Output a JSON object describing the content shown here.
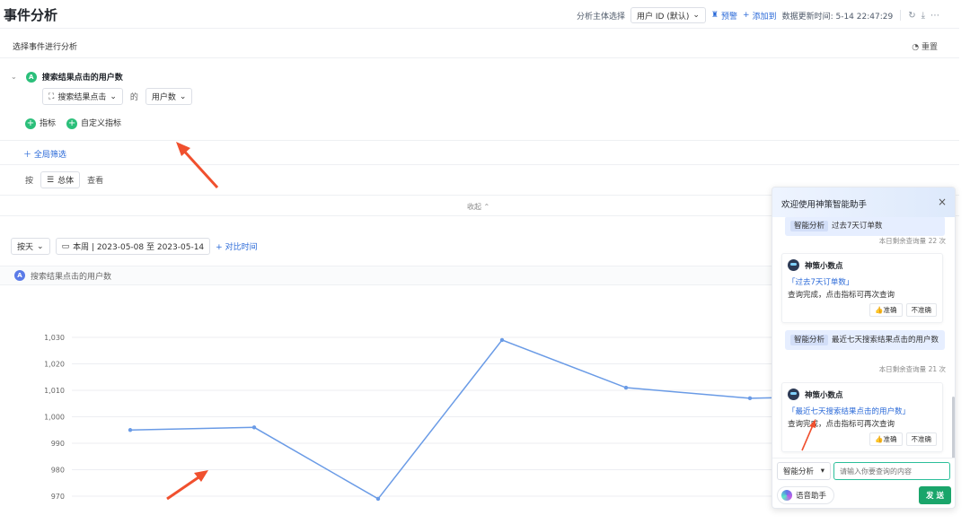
{
  "header": {
    "title": "事件分析",
    "subject_label": "分析主体选择",
    "subject_value": "用户 ID (默认)",
    "alert_label": "预警",
    "add_label": "添加到",
    "update_label": "数据更新时间: 5-14 22:47:29"
  },
  "panel": {
    "section_title": "选择事件进行分析",
    "reset_label": "重置",
    "event_badge": "A",
    "event_name": "搜索结果点击的用户数",
    "event_select": "搜索结果点击",
    "of_label": "的",
    "metric_select": "用户数",
    "add_metric_label": "指标",
    "add_custom_metric_label": "自定义指标",
    "global_filter_label": "全局筛选",
    "group_by_prefix": "按",
    "group_by_value": "总体",
    "group_by_suffix": "查看",
    "collapse_label": "收起"
  },
  "controls": {
    "granularity": "按天",
    "date_range": "本周 | 2023-05-08 至 2023-05-14",
    "compare_label": "对比时间"
  },
  "legend": {
    "badge": "A",
    "label": "搜索结果点击的用户数"
  },
  "colors": {
    "accent_blue": "#2b6ad8",
    "accent_green": "#2bbf7a",
    "line": "#6a9be6",
    "annotation_red": "#f0502e"
  },
  "chart_data": {
    "type": "line",
    "yticks": [
      "1,030",
      "1,020",
      "1,010",
      "1,000",
      "990",
      "980",
      "970"
    ],
    "ylim": [
      960,
      1035
    ],
    "x": [
      1,
      2,
      3,
      4,
      5,
      6,
      7
    ],
    "series": [
      {
        "values": [
          995,
          996,
          969,
          1029,
          1011,
          1007,
          1008
        ]
      }
    ],
    "grid": true
  },
  "assistant": {
    "title": "欢迎使用神策智能助手",
    "close_icon": "close-icon",
    "messages": [
      {
        "kind": "question",
        "tag": "智能分析",
        "text": "过去7天订单数",
        "remain": "本日剩余查询量 22 次"
      },
      {
        "kind": "answer",
        "bot": "神策小数点",
        "link": "「过去7天订单数」",
        "text": "查询完成，点击指标可再次查询",
        "good": "准确",
        "bad": "不准确"
      },
      {
        "kind": "question",
        "tag": "智能分析",
        "text": "最近七天搜索结果点击的用户数",
        "remain": "本日剩余查询量 21 次"
      },
      {
        "kind": "answer",
        "bot": "神策小数点",
        "link": "「最近七天搜索结果点击的用户数」",
        "text": "查询完成，点击指标可再次查询",
        "good": "准确",
        "bad": "不准确"
      }
    ],
    "mode_select": "智能分析",
    "input_placeholder": "请输入你要查询的内容",
    "voice_label": "语音助手",
    "send_label": "发 送"
  }
}
